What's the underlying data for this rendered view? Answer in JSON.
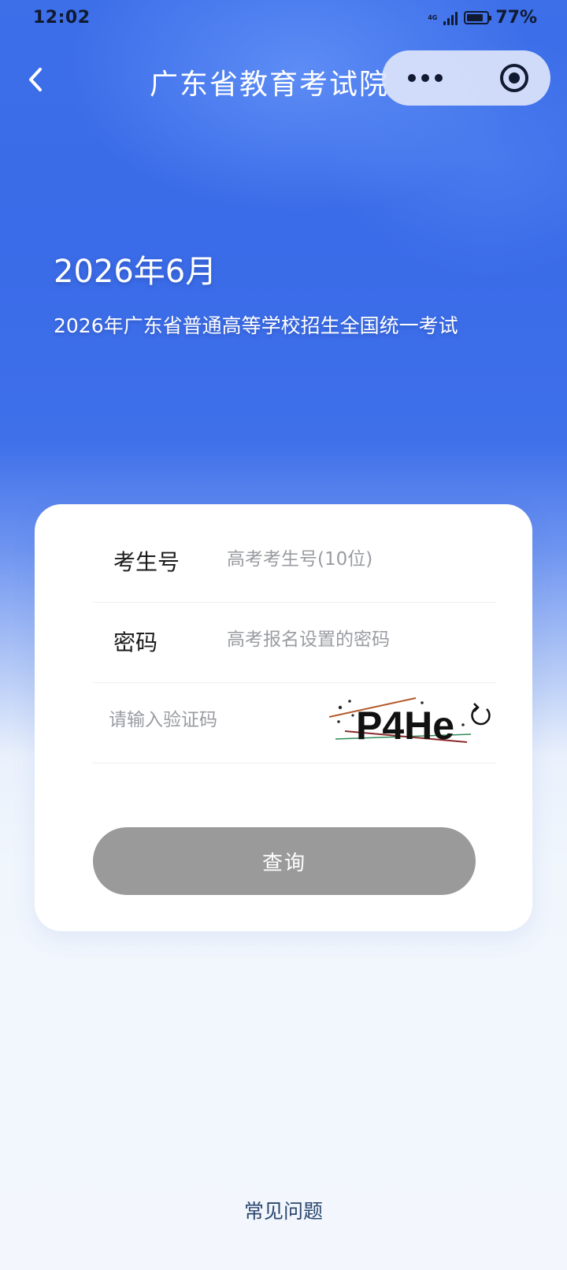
{
  "status_bar": {
    "time": "12:02",
    "network": "4G",
    "battery": "77%"
  },
  "nav": {
    "title": "广东省教育考试院",
    "back_icon": "chevron-left-icon",
    "more_icon": "more-dots-icon",
    "close_icon": "target-close-icon"
  },
  "hero": {
    "date": "2026年6月",
    "exam_name": "2026年广东省普通高等学校招生全国统一考试"
  },
  "form": {
    "candidate_id": {
      "label": "考生号",
      "placeholder": "高考考生号(10位)"
    },
    "password": {
      "label": "密码",
      "placeholder": "高考报名设置的密码"
    },
    "captcha": {
      "placeholder": "请输入验证码",
      "code": "P4He",
      "refresh_icon": "refresh-icon"
    },
    "submit_label": "查询"
  },
  "footer": {
    "faq_label": "常见问题"
  },
  "colors": {
    "primary_blue": "#3d6fe9",
    "button_disabled": "#9a9a9a",
    "card_bg": "#ffffff",
    "link": "#2a4670"
  }
}
